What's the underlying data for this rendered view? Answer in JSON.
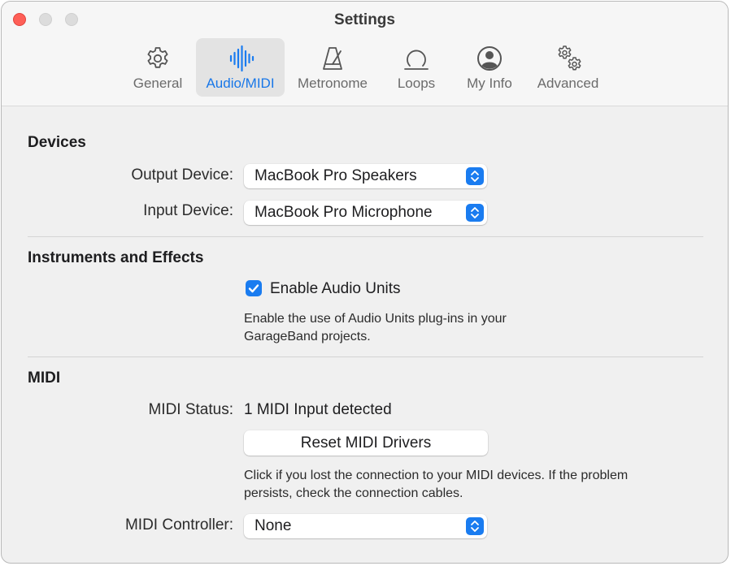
{
  "window": {
    "title": "Settings"
  },
  "tabs": [
    {
      "label": "General",
      "icon": "gear-icon",
      "active": false
    },
    {
      "label": "Audio/MIDI",
      "icon": "waveform-icon",
      "active": true
    },
    {
      "label": "Metronome",
      "icon": "metronome-icon",
      "active": false
    },
    {
      "label": "Loops",
      "icon": "loop-icon",
      "active": false
    },
    {
      "label": "My Info",
      "icon": "person-circle-icon",
      "active": false
    },
    {
      "label": "Advanced",
      "icon": "gears-icon",
      "active": false
    }
  ],
  "devices": {
    "title": "Devices",
    "output_label": "Output Device:",
    "output_value": "MacBook Pro Speakers",
    "input_label": "Input Device:",
    "input_value": "MacBook Pro Microphone"
  },
  "instruments": {
    "title": "Instruments and Effects",
    "enable_label": "Enable Audio Units",
    "enable_checked": true,
    "desc_line1": "Enable the use of Audio Units plug-ins in your",
    "desc_line2": "GarageBand projects."
  },
  "midi": {
    "title": "MIDI",
    "status_label": "MIDI Status:",
    "status_value": "1 MIDI Input detected",
    "reset_button": "Reset MIDI Drivers",
    "desc_line1": "Click if you lost the connection to your MIDI devices. If the problem",
    "desc_line2": "persists, check the connection cables.",
    "controller_label": "MIDI Controller:",
    "controller_value": "None"
  },
  "colors": {
    "accent": "#1a7cf0",
    "close": "#fe5f57"
  }
}
